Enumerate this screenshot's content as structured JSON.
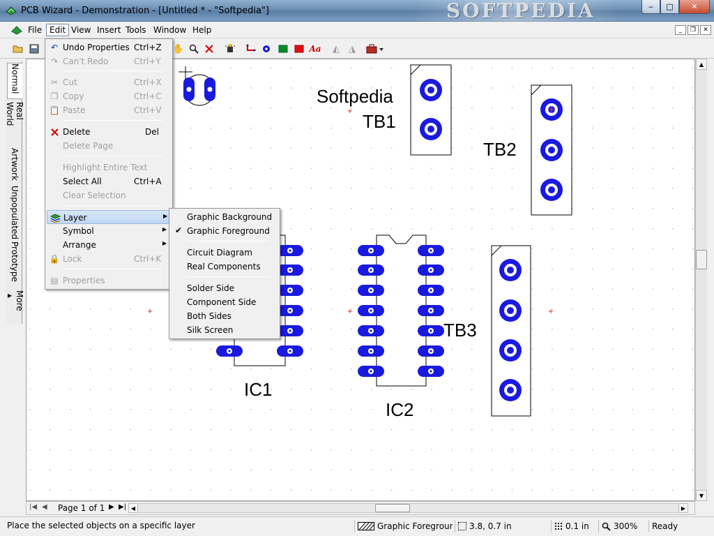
{
  "window": {
    "title": "PCB Wizard - Demonstration - [Untitled * - \"Softpedia\"]",
    "watermark": "SOFTPEDIA",
    "buttons": {
      "minimize": "‒",
      "maximize": "□",
      "close": "✕"
    }
  },
  "menubar": {
    "items": [
      {
        "label": "File"
      },
      {
        "label": "Edit"
      },
      {
        "label": "View"
      },
      {
        "label": "Insert"
      },
      {
        "label": "Tools"
      },
      {
        "label": "Window"
      },
      {
        "label": "Help"
      }
    ],
    "active": "Edit"
  },
  "left_tabs": [
    "Normal",
    "Real World",
    "Artwork",
    "Unpopulated",
    "Prototype",
    "More ▸"
  ],
  "edit_menu": {
    "items": [
      {
        "label": "Undo Properties",
        "shortcut": "Ctrl+Z",
        "icon": "undo-icon",
        "disabled": false
      },
      {
        "label": "Can't Redo",
        "shortcut": "Ctrl+Y",
        "icon": "redo-icon",
        "disabled": true
      },
      {
        "label": "Cut",
        "shortcut": "Ctrl+X",
        "icon": "cut-icon",
        "disabled": true
      },
      {
        "label": "Copy",
        "shortcut": "Ctrl+C",
        "icon": "copy-icon",
        "disabled": true
      },
      {
        "label": "Paste",
        "shortcut": "Ctrl+V",
        "icon": "paste-icon",
        "disabled": true
      },
      {
        "label": "Delete",
        "shortcut": "Del",
        "icon": "delete-icon",
        "disabled": false
      },
      {
        "label": "Delete Page",
        "shortcut": "",
        "icon": "",
        "disabled": true
      },
      {
        "label": "Highlight Entire Text",
        "shortcut": "",
        "icon": "",
        "disabled": true
      },
      {
        "label": "Select All",
        "shortcut": "Ctrl+A",
        "icon": "",
        "disabled": false
      },
      {
        "label": "Clear Selection",
        "shortcut": "",
        "icon": "",
        "disabled": true
      },
      {
        "label": "Layer",
        "shortcut": "",
        "icon": "layer-icon",
        "disabled": false,
        "submenu": true
      },
      {
        "label": "Symbol",
        "shortcut": "",
        "icon": "",
        "disabled": false,
        "submenu": true
      },
      {
        "label": "Arrange",
        "shortcut": "",
        "icon": "",
        "disabled": false,
        "submenu": true
      },
      {
        "label": "Lock",
        "shortcut": "Ctrl+K",
        "icon": "lock-icon",
        "disabled": true
      },
      {
        "label": "Properties",
        "shortcut": "",
        "icon": "properties-icon",
        "disabled": true
      }
    ]
  },
  "layer_submenu": {
    "items": [
      {
        "label": "Graphic Background",
        "checked": false
      },
      {
        "label": "Graphic Foreground",
        "checked": true
      },
      {
        "label": "Circuit Diagram",
        "checked": false
      },
      {
        "label": "Real Components",
        "checked": false
      },
      {
        "label": "Solder Side",
        "checked": false
      },
      {
        "label": "Component Side",
        "checked": false
      },
      {
        "label": "Both Sides",
        "checked": false
      },
      {
        "label": "Silk Screen",
        "checked": false
      }
    ]
  },
  "canvas": {
    "labels": {
      "softpedia": "Softpedia",
      "tb1": "TB1",
      "tb2": "TB2",
      "tb3": "TB3",
      "ic1": "IC1",
      "ic2": "IC2"
    },
    "pad_color": "#1a1adf"
  },
  "navigation": {
    "page_label": "Page 1 of 1"
  },
  "statusbar": {
    "hint": "Place the selected objects on a specific layer",
    "layer": "Graphic Foreground",
    "coords": "3.8, 0.7 in",
    "grid": "0.1 in",
    "zoom": "300%",
    "state": "Ready"
  },
  "colors": {
    "menu_highlight": "#c0d6f2",
    "canvas": "#ffffff",
    "titlebar": "#6c8fb4"
  }
}
